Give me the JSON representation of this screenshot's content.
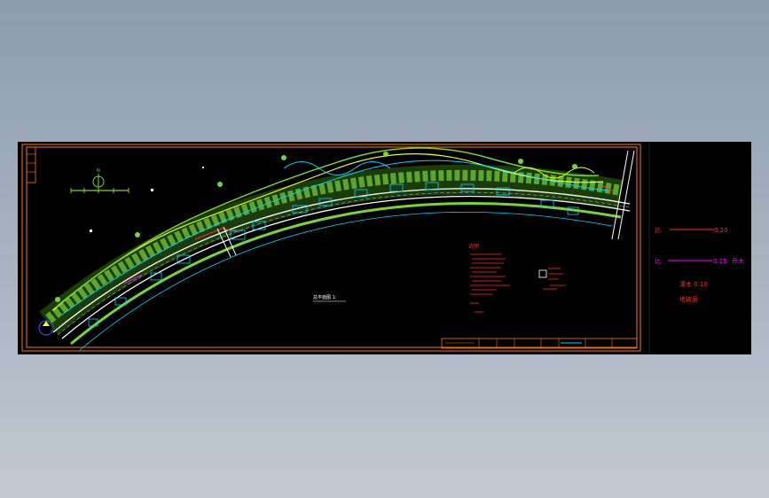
{
  "legend": {
    "line1_prefix": "比",
    "line1_value": "0.20",
    "line2_prefix": "比",
    "line2_value": "0.15",
    "line2_suffix": "乔木",
    "line3": "灌木 0.10",
    "line4": "地被层"
  },
  "plan_title": "总平面图 1:",
  "notes_title": "说明",
  "colors": {
    "frame": "#ff7a00",
    "road": "#ffffff",
    "green": "#7bd23a",
    "yellow": "#e6ff2b",
    "cyan": "#00d5ff",
    "red": "#ff2a2a",
    "magenta": "#ff00ff"
  }
}
